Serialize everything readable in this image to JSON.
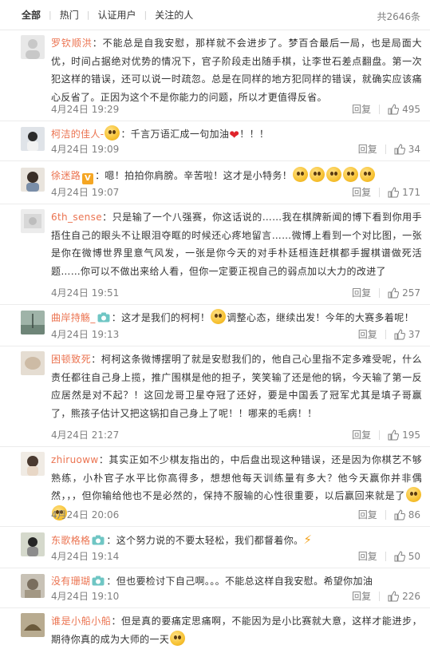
{
  "tabs": [
    {
      "label": "全部",
      "active": true
    },
    {
      "label": "热门",
      "active": false
    },
    {
      "label": "认证用户",
      "active": false
    },
    {
      "label": "关注的人",
      "active": false
    }
  ],
  "total_label": "共2646条",
  "reply_label": "回复",
  "comments": [
    {
      "user": "罗钦顺洪",
      "text": "：不能总是自我安慰，那样就不会进步了。梦百合最后一局，也是局面大优，时间占据绝对优势的情况下，官子阶段走出随手棋，让李世石差点翻盘。第一次犯这样的错误，还可以说一时疏忽。总是在同样的地方犯同样的错误，就确实应该痛心反省了。正因为这个不是你能力的问题，所以才更值得反省。",
      "time": "4月24日 19:29",
      "likes": "495"
    },
    {
      "user": "柯洁的佳人-",
      "text": "：千言万语汇成一句加油",
      "tail": "！！！",
      "time": "4月24日 19:09",
      "likes": "34"
    },
    {
      "user": "徐迷路",
      "text": "：嗯！拍拍你肩膀。辛苦啦！这才是小特务！",
      "time": "4月24日 19:07",
      "likes": "171"
    },
    {
      "user": "6th_sense",
      "text": "：只是输了一个八强赛，你这话说的……我在棋牌新闻的博下看到你用手捂住自己的眼头不让眼泪夺眶的时候还心疼地留言……微博上看到一个对比图，一张是你在微博世界里意气风发，一张是你今天的对手朴廷桓连赶棋都手握棋谱做死活题……你可以不做出来给人看，但你一定要正视自己的弱点加以大力的改进了",
      "time": "4月24日 19:51",
      "likes": "257"
    },
    {
      "user": "曲岸持觞_",
      "text": "：这才是我们的柯柯！",
      "tail": "调整心态，继续出发！今年的大赛多着呢！",
      "time": "4月24日 19:13",
      "likes": "37"
    },
    {
      "user": "困顿致死",
      "text": "：柯柯这条微博摆明了就是安慰我们的，他自己心里指不定多难受呢，什么责任都往自己身上揽，推广围棋是他的担子，笑笑输了还是他的锅，今天输了第一反应居然是对不起？！这回龙哥卫星夺冠了还好，要是中国丢了冠军尤其是填子哥赢了，熊孩子估计又把这锅扣自己身上了呢！！哪来的毛病！！",
      "time": "4月24日 21:27",
      "likes": "195"
    },
    {
      "user": "zhiruoww",
      "text": "：其实正如不少棋友指出的，中后盘出现这种错误，还是因为你棋艺不够熟练，小朴官子水平比你高得多，想想他每天训练量有多大？他今天赢你并非偶然，，，但你输给他也不是必然的，保持不服输的心性很重要，以后赢回来就是了",
      "time": "4月24日 20:06",
      "likes": "86"
    },
    {
      "user": "东歌格格",
      "text": "：这个努力说的不要太轻松，我们都督着你。",
      "time": "4月24日 19:14",
      "likes": "50"
    },
    {
      "user": "没有珊瑚",
      "text": "：但也要检讨下自己啊。。。不能总这样自我安慰。希望你加油",
      "time": "4月24日 19:10",
      "likes": "226"
    },
    {
      "user": "谁是小船小船",
      "text": "：但是真的要痛定思痛啊，不能因为是小比赛就大意，这样才能进步，期待你真的成为大师的一天"
    }
  ]
}
